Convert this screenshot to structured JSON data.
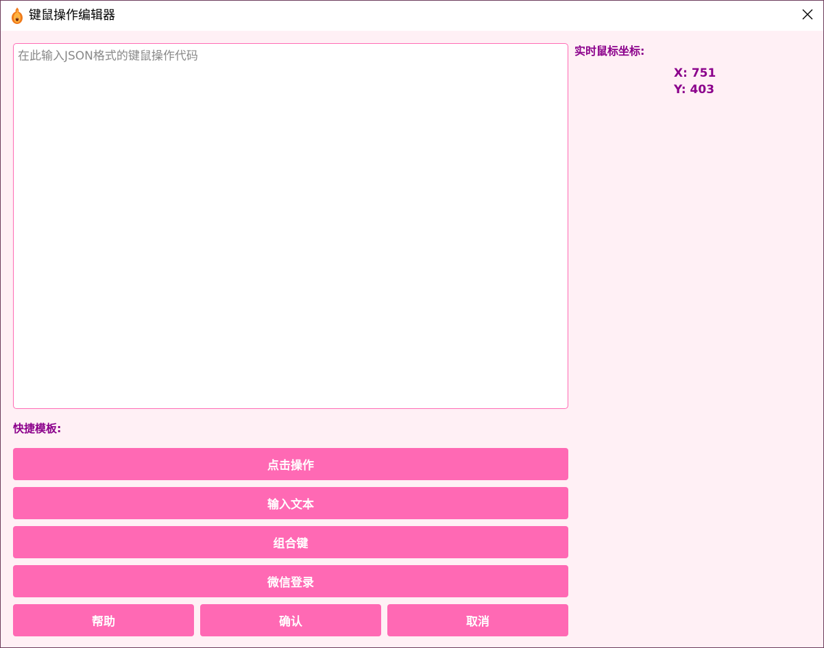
{
  "window": {
    "title": "键鼠操作编辑器",
    "icon": "flame-gourd-icon",
    "close_icon": "close-icon"
  },
  "editor": {
    "value": "",
    "placeholder": "在此输入JSON格式的键鼠操作代码"
  },
  "coordinates": {
    "title": "实时鼠标坐标:",
    "x_text": "X: 751",
    "y_text": "Y: 403"
  },
  "templates": {
    "title": "快捷模板:",
    "buttons": [
      {
        "label": "点击操作"
      },
      {
        "label": "输入文本"
      },
      {
        "label": "组合键"
      },
      {
        "label": "微信登录"
      }
    ]
  },
  "actions": {
    "help_label": "帮助",
    "confirm_label": "确认",
    "cancel_label": "取消"
  },
  "colors": {
    "background": "#fff0f5",
    "accent": "#ff69b4",
    "label": "#8b008b",
    "button_text": "#ffffff"
  }
}
